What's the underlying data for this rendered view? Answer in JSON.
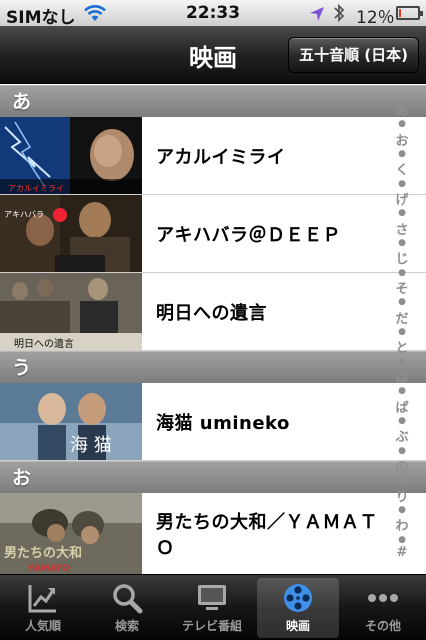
{
  "status_bar": {
    "carrier": "SIMなし",
    "time": "22:33",
    "battery_percent": "12％",
    "battery_level": 0.12,
    "icons": [
      "wifi-icon",
      "location-icon",
      "bluetooth-icon",
      "battery-icon"
    ]
  },
  "nav": {
    "title": "映画",
    "sort_button": "五十音順 (日本)"
  },
  "sections": [
    {
      "header": "あ",
      "items": [
        {
          "title": "アカルイミライ",
          "thumb": "akarui-mirai-poster"
        },
        {
          "title": "アキハバラ＠ＤＥＥＰ",
          "thumb": "akihabara-deep-poster"
        },
        {
          "title": "明日への遺言",
          "thumb": "ashita-e-no-yuigon-poster"
        }
      ]
    },
    {
      "header": "う",
      "items": [
        {
          "title": "海猫 umineko",
          "thumb": "umineko-poster"
        }
      ]
    },
    {
      "header": "お",
      "items": [
        {
          "title": "男たちの大和／ＹＡＭＡＴＯ",
          "thumb": "otokotachi-no-yamato-poster"
        }
      ]
    }
  ],
  "index_bar": [
    "あ",
    "●",
    "お",
    "●",
    "く",
    "●",
    "げ",
    "●",
    "さ",
    "●",
    "じ",
    "●",
    "そ",
    "●",
    "だ",
    "●",
    "と",
    "●",
    "は",
    "●",
    "ぱ",
    "●",
    "ぶ",
    "●",
    "の",
    "●",
    "り",
    "●",
    "わ",
    "●",
    "#"
  ],
  "tabs": [
    {
      "label": "人気順",
      "icon": "chart-icon",
      "active": false
    },
    {
      "label": "検索",
      "icon": "search-icon",
      "active": false
    },
    {
      "label": "テレビ番組",
      "icon": "tv-icon",
      "active": false
    },
    {
      "label": "映画",
      "icon": "film-reel-icon",
      "active": true
    },
    {
      "label": "その他",
      "icon": "more-icon",
      "active": false
    }
  ],
  "colors": {
    "accent_battery_low": "#e23a2c",
    "location_arrow": "#7d53d6"
  }
}
